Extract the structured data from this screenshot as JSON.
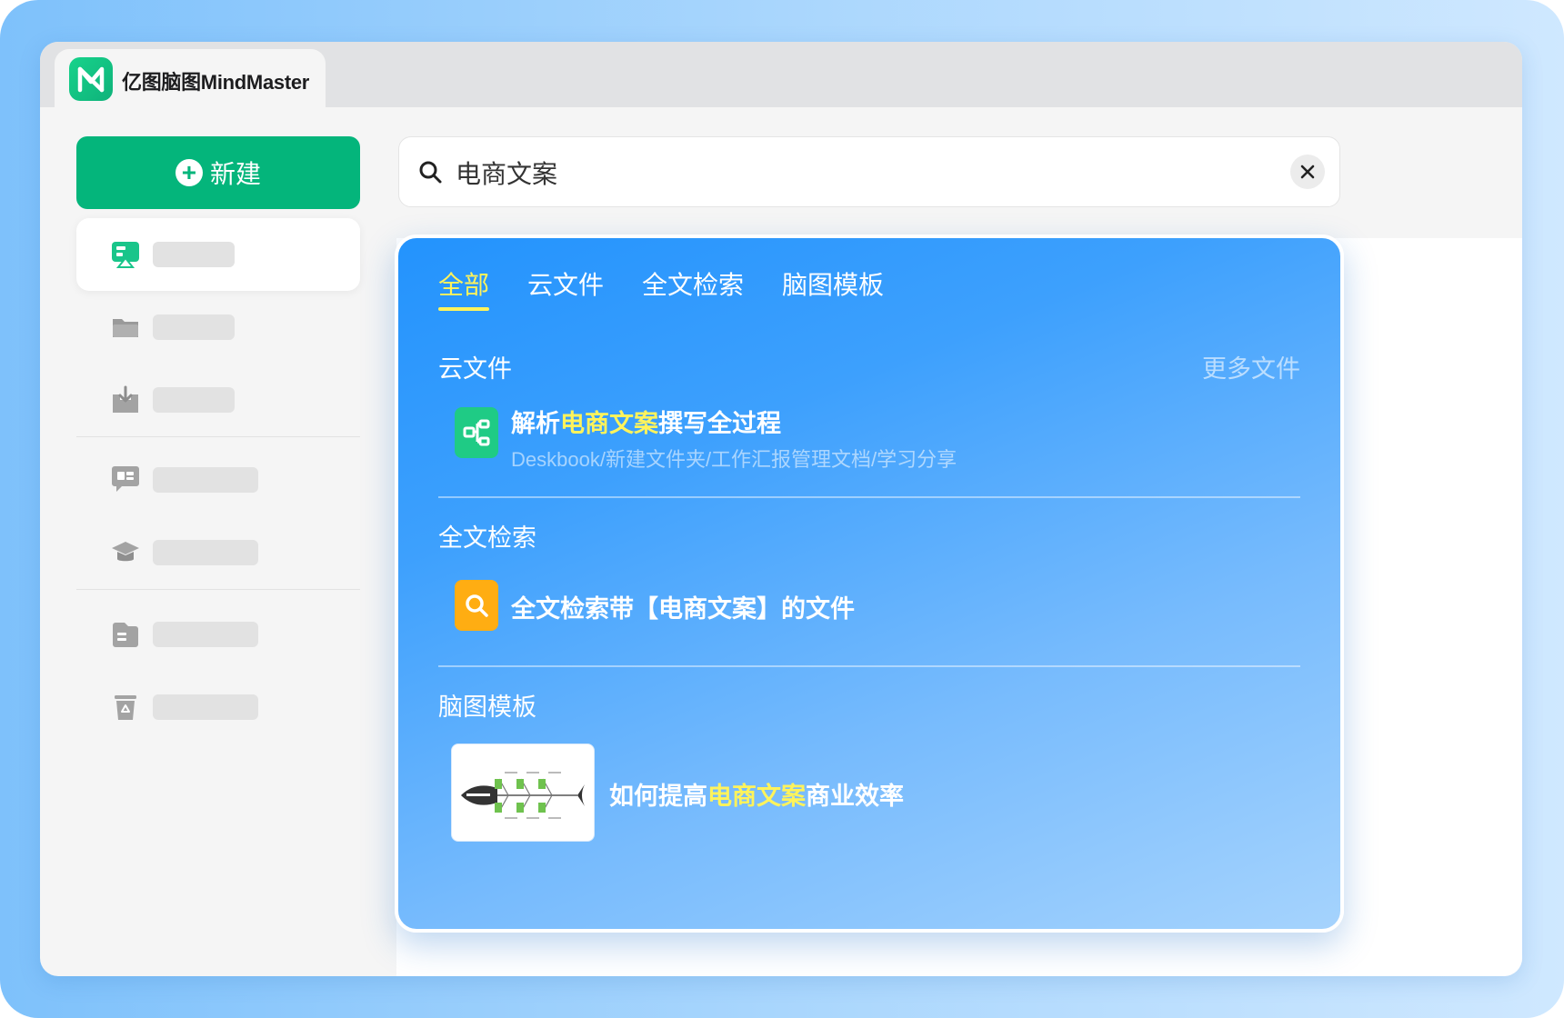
{
  "app": {
    "title": "亿图脑图MindMaster"
  },
  "sidebar": {
    "new_label": "新建"
  },
  "search": {
    "value": "电商文案"
  },
  "panel": {
    "tabs": [
      "全部",
      "云文件",
      "全文检索",
      "脑图模板"
    ],
    "active_tab": 0,
    "cloud": {
      "title": "云文件",
      "more": "更多文件",
      "result": {
        "title_prefix": "解析",
        "title_highlight": "电商文案",
        "title_suffix": "撰写全过程",
        "path": "Deskbook/新建文件夹/工作汇报管理文档/学习分享"
      }
    },
    "fulltext": {
      "title": "全文检索",
      "result": "全文检索带【电商文案】的文件"
    },
    "template": {
      "title": "脑图模板",
      "result": {
        "prefix": "如何提高",
        "highlight": "电商文案",
        "suffix": "商业效率"
      }
    }
  },
  "colors": {
    "brand_green": "#04b57b",
    "highlight_yellow": "#fff35b",
    "panel_blue": "#2393fd"
  }
}
